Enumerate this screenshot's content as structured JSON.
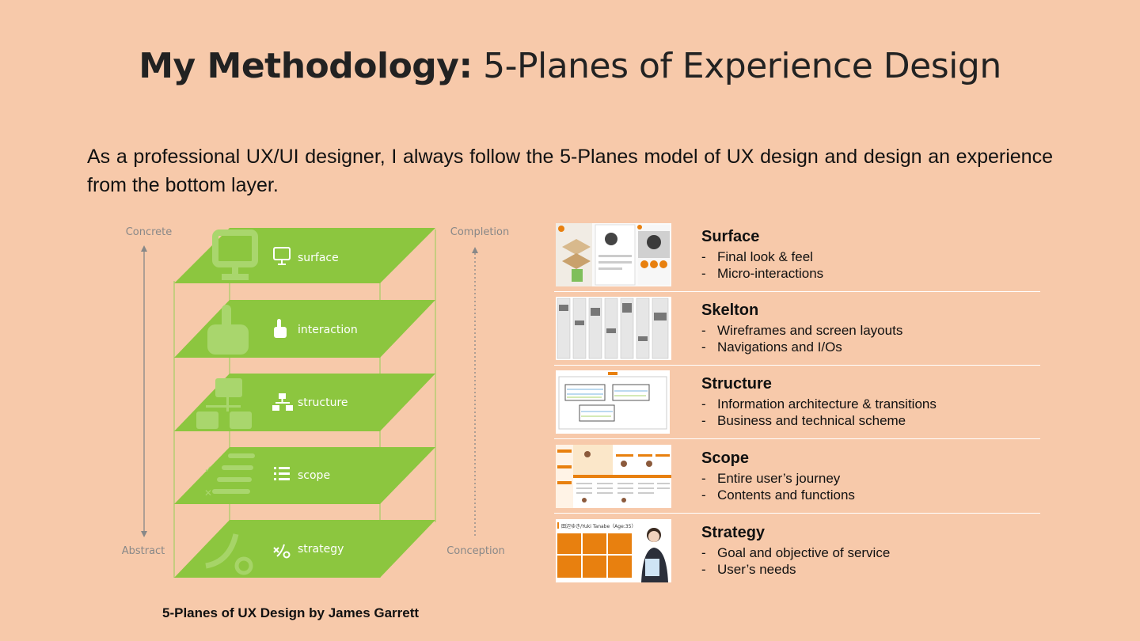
{
  "header": {
    "title_bold": "My Methodology:",
    "title_rest": "5-Planes of Experience Design"
  },
  "intro": "As a professional UX/UI designer, I always follow the 5-Planes model of UX design and design an experience from the bottom layer.",
  "diagram": {
    "label_concrete": "Concrete",
    "label_abstract": "Abstract",
    "label_completion": "Completion",
    "label_conception": "Conception",
    "planes": [
      "surface",
      "interaction",
      "structure",
      "scope",
      "strategy"
    ],
    "plane_color": "#8cc63f",
    "caption": "5-Planes of UX Design by James Garrett"
  },
  "planes_list": [
    {
      "title": "Surface",
      "bullets": [
        "Final look & feel",
        "Micro-interactions"
      ]
    },
    {
      "title": "Skelton",
      "bullets": [
        "Wireframes and screen layouts",
        "Navigations and I/Os"
      ]
    },
    {
      "title": "Structure",
      "bullets": [
        "Information architecture & transitions",
        "Business and technical scheme"
      ]
    },
    {
      "title": "Scope",
      "bullets": [
        "Entire user’s journey",
        "Contents and functions"
      ]
    },
    {
      "title": "Strategy",
      "bullets": [
        "Goal and objective of service",
        "User’s needs"
      ]
    }
  ],
  "strategy_thumb": {
    "heading": "田辺ゆき/Yuki Tanabe（Age:35）",
    "accent": "#e8800f"
  },
  "accent_orange": "#e8800f",
  "dash": "-"
}
